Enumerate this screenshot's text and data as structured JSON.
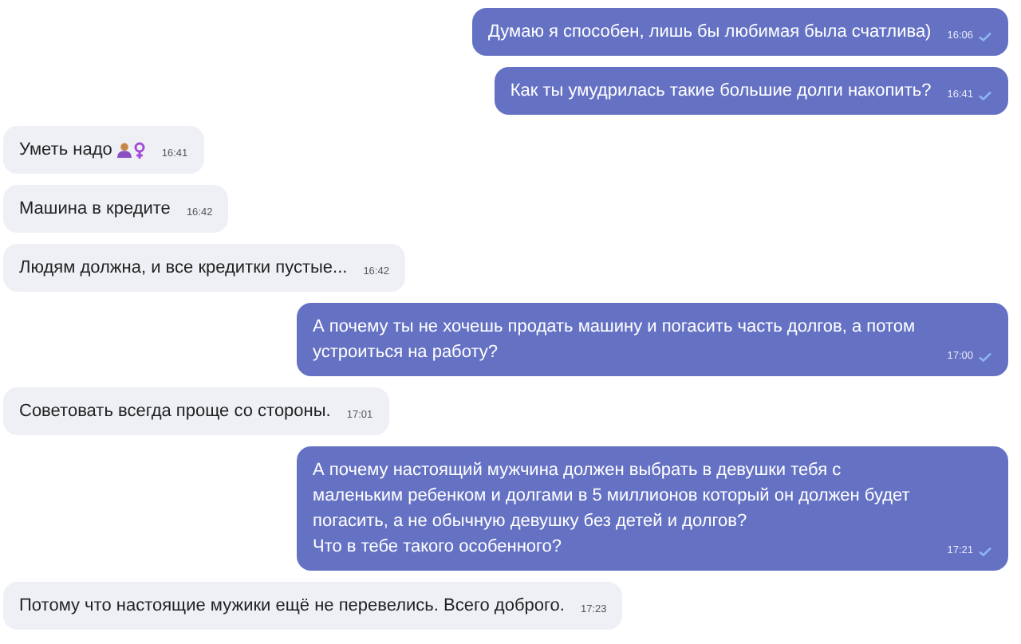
{
  "messages": [
    {
      "kind": "outgoing",
      "text": "Думаю я способен, лишь бы любимая была счатлива)",
      "time": "16:06"
    },
    {
      "kind": "outgoing",
      "text": "Как ты умудрилась такие большие долги накопить?",
      "time": "16:41"
    },
    {
      "kind": "incoming",
      "text": "Уметь надо",
      "has_emoji": true,
      "time": "16:41"
    },
    {
      "kind": "incoming",
      "text": "Машина в кредите",
      "time": "16:42"
    },
    {
      "kind": "incoming",
      "text": "Людям должна, и все кредитки пустые...",
      "time": "16:42"
    },
    {
      "kind": "outgoing",
      "text": "А почему ты не хочешь продать машину и погасить часть долгов, а потом устроиться на работу?",
      "time": "17:00"
    },
    {
      "kind": "incoming",
      "text": "Советовать всегда проще со стороны.",
      "time": "17:01"
    },
    {
      "kind": "outgoing",
      "text": "А почему настоящий мужчина должен выбрать в девушки тебя с маленьким ребенком и долгами в 5 миллионов который он должен будет погасить, а не обычную девушку без детей и долгов?\nЧто в тебе такого особенного?",
      "time": "17:21"
    },
    {
      "kind": "incoming",
      "text": "Потому что настоящие мужики ещё не перевелись. Всего доброго.",
      "time": "17:23"
    }
  ]
}
